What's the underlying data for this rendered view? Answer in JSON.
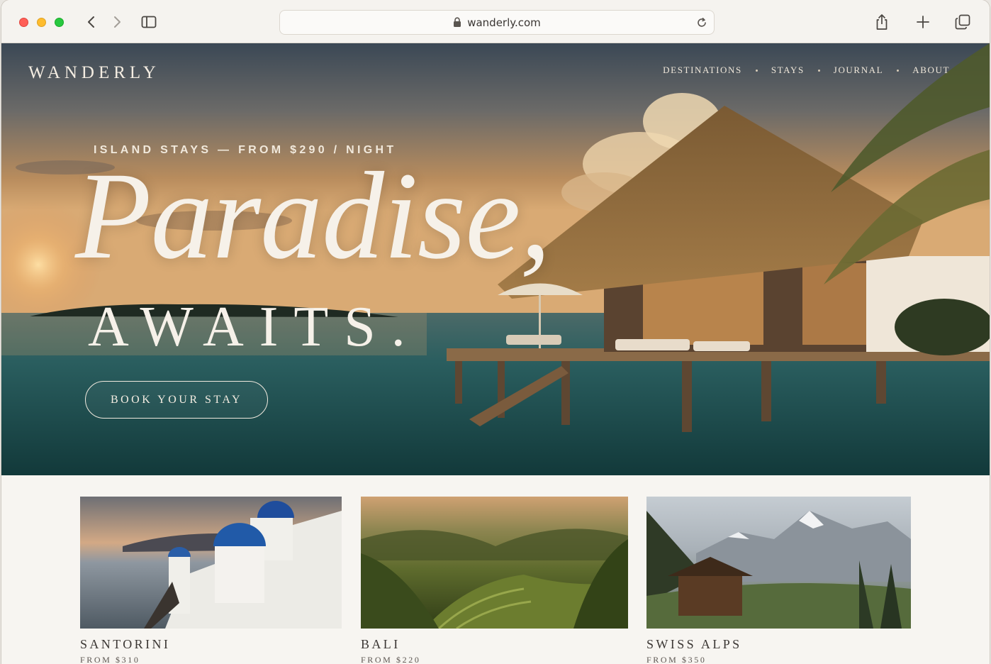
{
  "browser": {
    "url": "wanderly.com"
  },
  "site": {
    "brand": "WANDERLY",
    "nav": [
      "DESTINATIONS",
      "STAYS",
      "JOURNAL",
      "ABOUT"
    ]
  },
  "hero": {
    "eyebrow": "ISLAND STAYS — FROM $290 / NIGHT",
    "headline_1": "Paradise,",
    "headline_2": "AWAITS.",
    "cta": "BOOK YOUR STAY"
  },
  "destinations": [
    {
      "name": "SANTORINI",
      "price": "FROM $310"
    },
    {
      "name": "BALI",
      "price": "FROM $220"
    },
    {
      "name": "SWISS ALPS",
      "price": "FROM $350"
    }
  ],
  "icons": {
    "back": "chevron-left-icon",
    "forward": "chevron-right-icon",
    "sidebar": "sidebar-icon",
    "lock": "lock-icon",
    "reload": "reload-icon",
    "share": "share-icon",
    "new_tab": "plus-icon",
    "tabs": "tab-overview-icon"
  }
}
